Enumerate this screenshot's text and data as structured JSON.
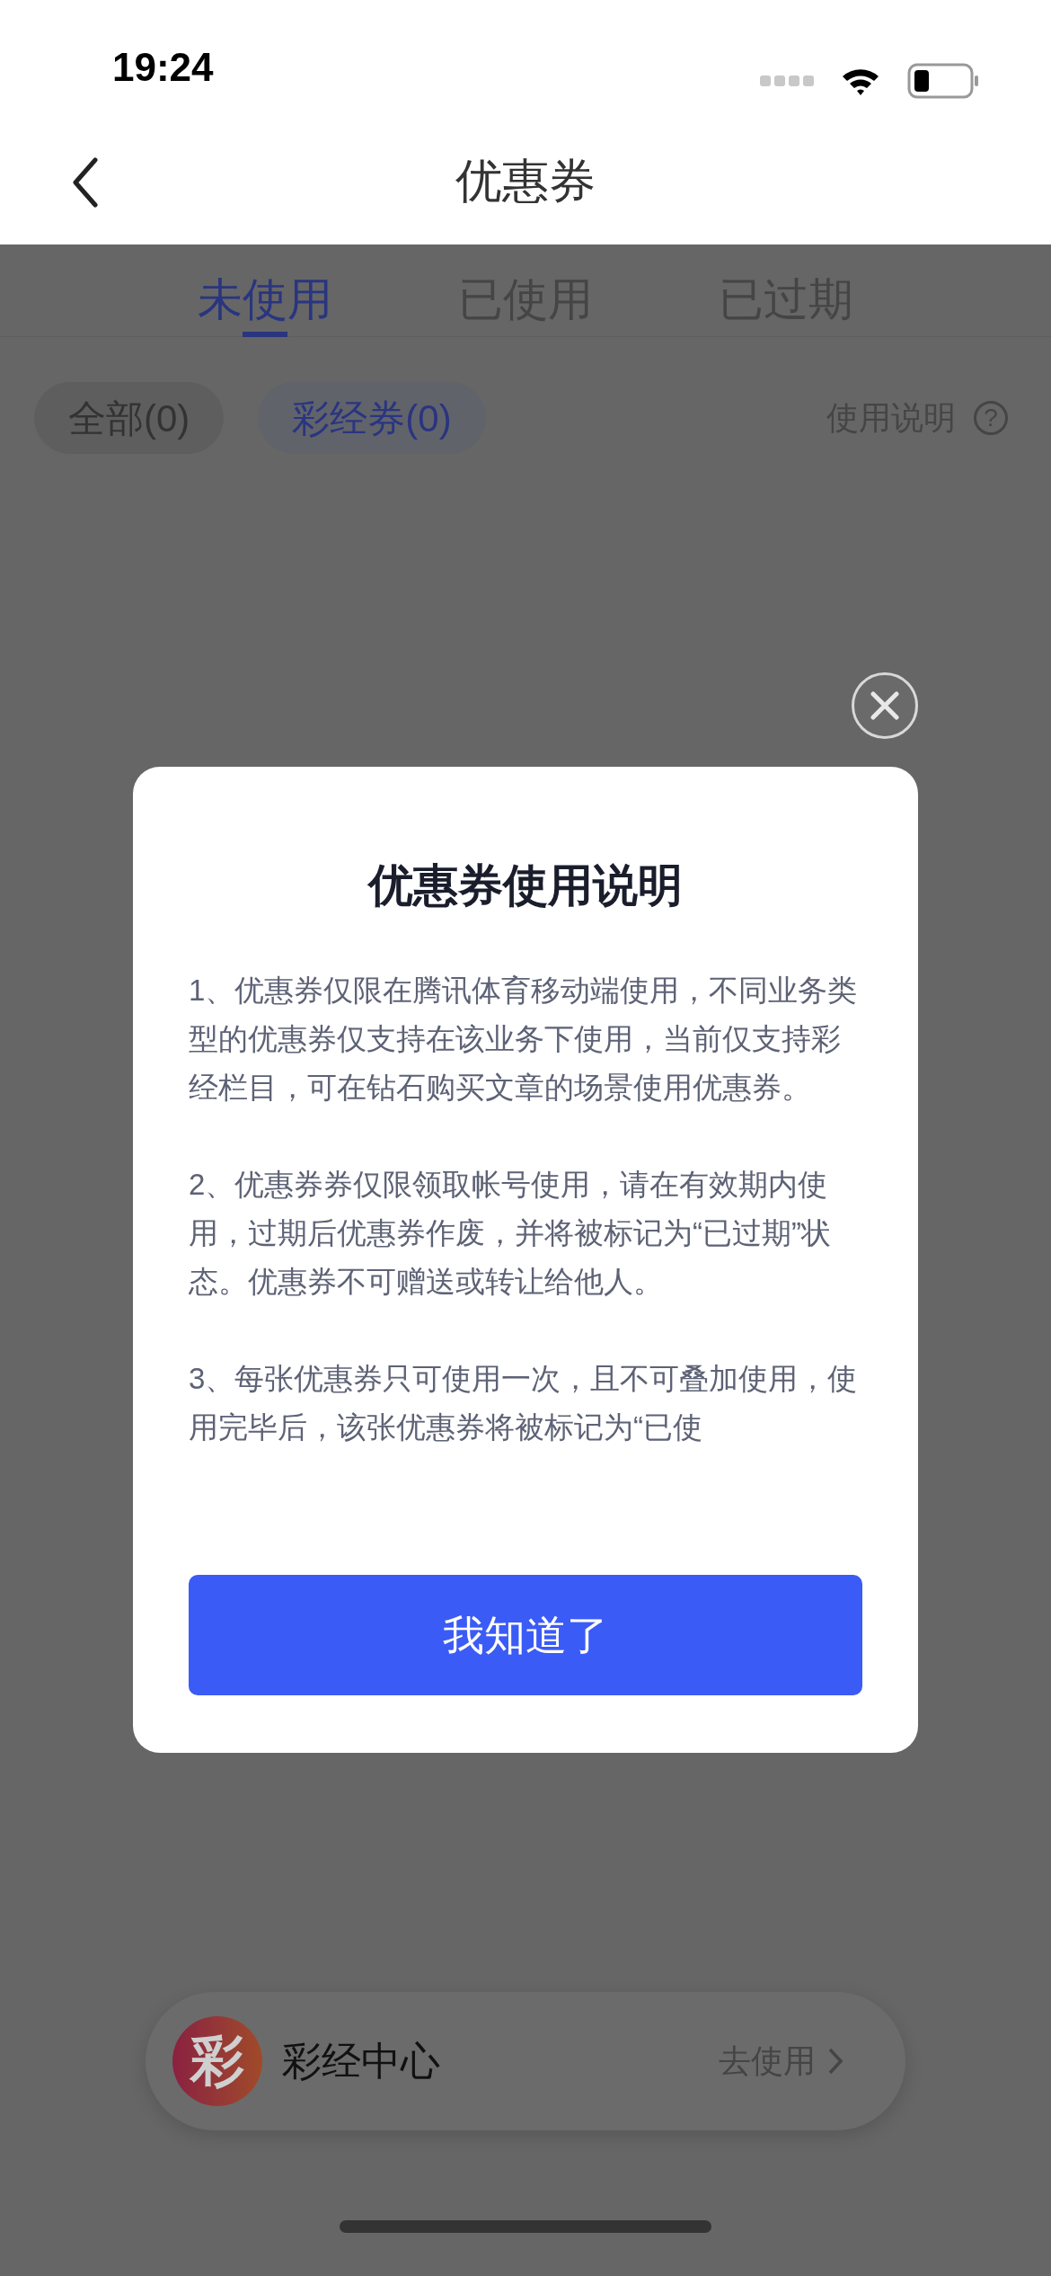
{
  "status_bar": {
    "time": "19:24"
  },
  "header": {
    "title": "优惠券"
  },
  "tabs": [
    {
      "label": "未使用",
      "selected": true
    },
    {
      "label": "已使用",
      "selected": false
    },
    {
      "label": "已过期",
      "selected": false
    }
  ],
  "filters": [
    {
      "label": "全部(0)",
      "selected": false
    },
    {
      "label": "彩经券(0)",
      "selected": true
    }
  ],
  "help_link": {
    "label": "使用说明",
    "icon_text": "?"
  },
  "promo_card": {
    "logo_char": "彩",
    "name": "彩经中心",
    "action": "去使用"
  },
  "dialog": {
    "title": "优惠券使用说明",
    "paragraphs": [
      "1、优惠券仅限在腾讯体育移动端使用，不同业务类型的优惠券仅支持在该业务下使用，当前仅支持彩经栏目，可在钻石购买文章的场景使用优惠券。",
      "2、优惠券券仅限领取帐号使用，请在有效期内使用，过期后优惠券作废，并将被标记为“已过期”状态。优惠券不可赠送或转让给他人。",
      "3、每张优惠券只可使用一次，且不可叠加使用，使用完毕后，该张优惠券将被标记为“已使"
    ],
    "button": "我知道了"
  }
}
